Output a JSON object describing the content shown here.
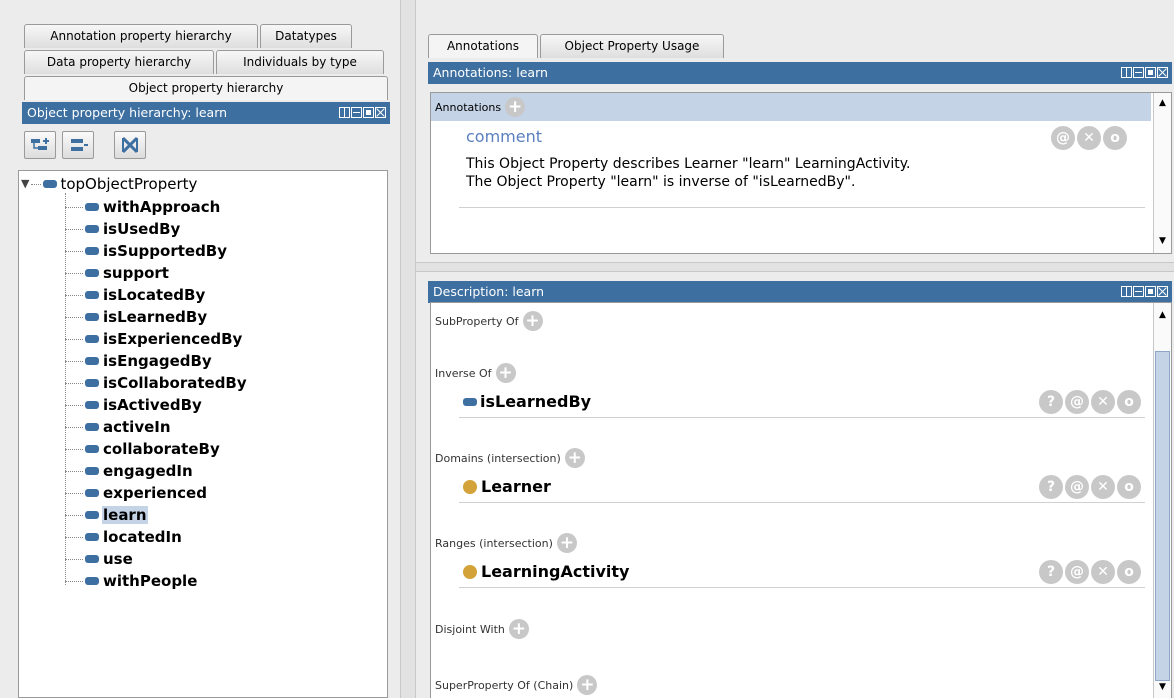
{
  "left_tabs": {
    "annotation_hierarchy": "Annotation property hierarchy",
    "datatypes": "Datatypes",
    "data_hierarchy": "Data property hierarchy",
    "individuals_by_type": "Individuals by type",
    "object_hierarchy": "Object property hierarchy"
  },
  "hierarchy_view": {
    "title": "Object property hierarchy: learn",
    "root": "topObjectProperty",
    "items": [
      "withApproach",
      "isUsedBy",
      "isSupportedBy",
      "support",
      "isLocatedBy",
      "isLearnedBy",
      "isExperiencedBy",
      "isEngagedBy",
      "isCollaboratedBy",
      "isActivedBy",
      "activeIn",
      "collaborateBy",
      "engagedIn",
      "experienced",
      "learn",
      "locatedIn",
      "use",
      "withPeople"
    ],
    "selected": "learn"
  },
  "right_tabs": {
    "annotations": "Annotations",
    "usage": "Object Property Usage"
  },
  "annotations_view": {
    "title": "Annotations: learn",
    "header_label": "Annotations",
    "comment_label": "comment",
    "comment_line1": "This Object Property describes Learner \"learn\" LearningActivity.",
    "comment_line2": "The Object Property \"learn\" is inverse of \"isLearnedBy\"."
  },
  "description_view": {
    "title": "Description: learn",
    "subproperty_of": "SubProperty Of",
    "inverse_of": "Inverse Of",
    "inverse_value": "isLearnedBy",
    "domains": "Domains (intersection)",
    "domain_value": "Learner",
    "ranges": "Ranges (intersection)",
    "range_value": "LearningActivity",
    "disjoint_with": "Disjoint With",
    "superproperty_chain": "SuperProperty Of (Chain)"
  },
  "colors": {
    "title_bar": "#3d6fa0",
    "selection": "#c5d3e6",
    "class_icon": "#d3a33a"
  }
}
